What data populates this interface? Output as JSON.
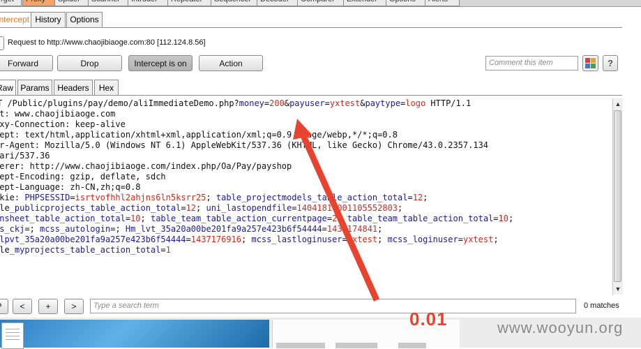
{
  "tool_tabs": [
    "rget",
    "Proxy",
    "Spider",
    "Scanner",
    "Intruder",
    "Repeater",
    "Sequencer",
    "Decoder",
    "Comparer",
    "Extender",
    "Options",
    "Alerts"
  ],
  "proxy_tabs": {
    "intercept": "Intercept",
    "history": "History",
    "options": "Options"
  },
  "request_info": "Request to http://www.chaojibiaoge.com:80  [112.124.8.56]",
  "buttons": {
    "forward": "Forward",
    "drop": "Drop",
    "intercept": "Intercept is on",
    "action": "Action",
    "help": "?"
  },
  "comment_placeholder": "Comment this item",
  "editor_tabs": [
    "Raw",
    "Params",
    "Headers",
    "Hex"
  ],
  "request_lines": {
    "l1_pre": "T /Public/plugins/pay/demo/aliImmediateDemo.php?",
    "p1n": "money",
    "eq": "=",
    "p1v": "200",
    "amp": "&",
    "p2n": "payuser",
    "p2v": "yxtest",
    "p3n": "paytype",
    "p3v": "logo",
    "l1_post": " HTTP/1.1",
    "l2": "st: www.chaojibiaoge.com",
    "l3": "oxy-Connection: keep-alive",
    "l4": "cept: text/html,application/xhtml+xml,application/xml;q=0.9,image/webp,*/*;q=0.8",
    "l5": "er-Agent: Mozilla/5.0 (Windows NT 6.1) AppleWebKit/537.36 (KHTML, like Gecko) Chrome/43.0.2357.134",
    "l6": "fari/537.36",
    "l7": "ferer: http://www.chaojibiaoge.com/index.php/Oa/Pay/payshop",
    "l8": "cept-Encoding: gzip, deflate, sdch",
    "l9": "cept-Language: zh-CN,zh;q=0.8",
    "cookie": {
      "c1_pre": "okie: ",
      "c1": [
        [
          "PHPSESSID",
          "isrtvofhhl2ahjns6ln5ksrr25"
        ],
        [
          "table_projectmodels_table_action_total",
          "12"
        ]
      ],
      "c2_pre": "ble_",
      "c2": [
        [
          "publicprojects_table_action_total",
          "12"
        ],
        [
          "uni_lastopendfile",
          "1404181700110555280З"
        ]
      ],
      "c3_pre": "",
      "c3": [
        [
          "ansheet_table_action_total",
          "10"
        ],
        [
          "table_team_table_action_currentpage",
          "2"
        ],
        [
          "table_team_table_action_total",
          "10"
        ]
      ],
      "c4_pre": "",
      "c4": [
        [
          "ss_ckj",
          ""
        ],
        [
          "mcss_autologin",
          ""
        ],
        [
          "Hm_lvt_35a20a00be201fa9a257e423b6f54444",
          "1437174841"
        ]
      ],
      "c5_pre": "",
      "c5": [
        [
          "_lpvt_35a20a00be201fa9a257e423b6f54444",
          "1437176916"
        ],
        [
          "mcss_lastloginuser",
          "yxtest"
        ],
        [
          "mcss_loginuser",
          "yxtest"
        ]
      ],
      "c6_pre": "ble_",
      "c6": [
        [
          "myprojects_table_action_total",
          "1"
        ]
      ]
    }
  },
  "search": {
    "help": "?",
    "prev": "<",
    "add": "+",
    "next": ">",
    "placeholder": "Type a search term",
    "matches": "0 matches"
  },
  "annotation": "0.01",
  "watermark": "www.wooyun.org",
  "colors": {
    "param_name": "#1a1a9a",
    "param_value": "#d4281c",
    "annotation": "#e8432e",
    "active_tab": "#f5a26b"
  }
}
